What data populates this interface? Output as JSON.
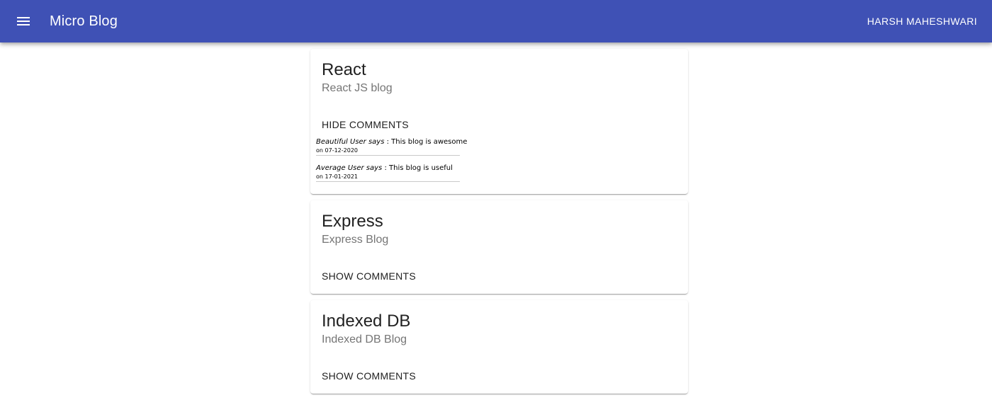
{
  "appbar": {
    "title": "Micro Blog",
    "user": "HARSH MAHESHWARI",
    "menu_icon": "menu-icon",
    "color": "#3f51b5"
  },
  "posts": [
    {
      "title": "React",
      "subtitle": "React JS blog",
      "toggle_label": "HIDE COMMENTS",
      "comments": [
        {
          "author": "Beautiful User says",
          "separator": " : ",
          "text": "This blog is awesome",
          "date": "on 07-12-2020"
        },
        {
          "author": "Average User says",
          "separator": " : ",
          "text": "This blog is useful",
          "date": "on 17-01-2021"
        }
      ]
    },
    {
      "title": "Express",
      "subtitle": "Express Blog",
      "toggle_label": "SHOW COMMENTS"
    },
    {
      "title": "Indexed DB",
      "subtitle": "Indexed DB Blog",
      "toggle_label": "SHOW COMMENTS"
    }
  ]
}
